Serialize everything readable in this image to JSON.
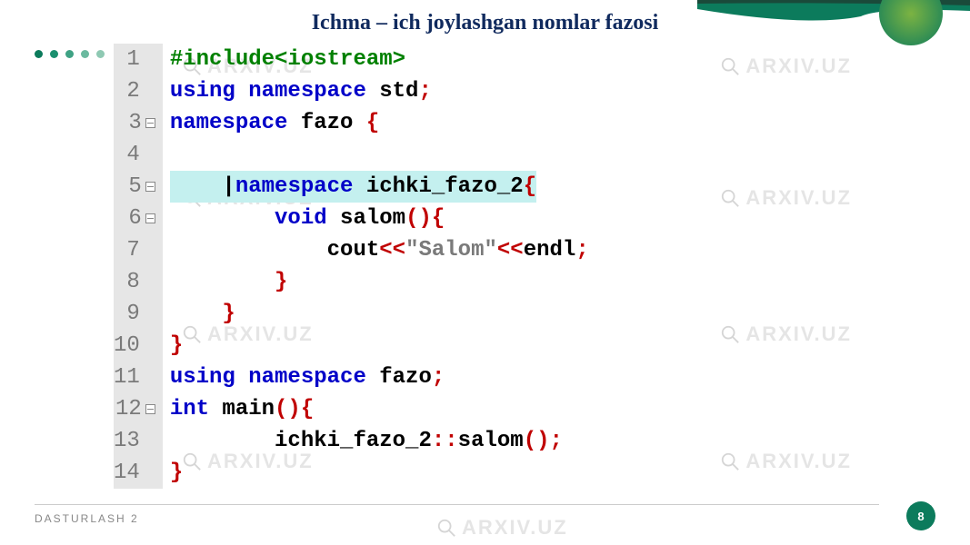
{
  "title": "Ichma – ich joylashgan nomlar fazosi",
  "footer": "DASTURLASH 2",
  "page_number": "8",
  "watermark_text": "ARXIV.UZ",
  "code": {
    "line_numbers": [
      "1",
      "2",
      "3",
      "4",
      "5",
      "6",
      "7",
      "8",
      "9",
      "10",
      "11",
      "12",
      "13",
      "14"
    ],
    "fold_lines": [
      3,
      5,
      6,
      12
    ],
    "lines": [
      {
        "t": "include",
        "tokens": [
          {
            "text": "#include<iostream>",
            "class": "c-green"
          }
        ]
      },
      {
        "t": "using_std",
        "tokens": [
          {
            "text": "using namespace ",
            "class": "c-blue"
          },
          {
            "text": "std",
            "class": "c-black"
          },
          {
            "text": ";",
            "class": "c-red"
          }
        ]
      },
      {
        "t": "ns_fazo",
        "tokens": [
          {
            "text": "namespace ",
            "class": "c-blue"
          },
          {
            "text": "fazo ",
            "class": "c-black"
          },
          {
            "text": "{",
            "class": "c-red"
          }
        ]
      },
      {
        "t": "blank",
        "tokens": [
          {
            "text": " ",
            "class": "c-black"
          }
        ]
      },
      {
        "t": "ns_ichki",
        "hl": true,
        "tokens": [
          {
            "text": "    ",
            "class": "c-black"
          },
          {
            "text": "|",
            "class": "c-black"
          },
          {
            "text": "namespace ",
            "class": "c-blue"
          },
          {
            "text": "ichki_fazo_2",
            "class": "c-black"
          },
          {
            "text": "{",
            "class": "c-red"
          }
        ]
      },
      {
        "t": "void_salom",
        "tokens": [
          {
            "text": "        ",
            "class": "c-black"
          },
          {
            "text": "void ",
            "class": "c-blue"
          },
          {
            "text": "salom",
            "class": "c-black"
          },
          {
            "text": "(){",
            "class": "c-red"
          }
        ]
      },
      {
        "t": "cout",
        "tokens": [
          {
            "text": "            cout",
            "class": "c-black"
          },
          {
            "text": "<<",
            "class": "c-red"
          },
          {
            "text": "\"Salom\"",
            "class": "c-gray"
          },
          {
            "text": "<<",
            "class": "c-red"
          },
          {
            "text": "endl",
            "class": "c-black"
          },
          {
            "text": ";",
            "class": "c-red"
          }
        ]
      },
      {
        "t": "close1",
        "tokens": [
          {
            "text": "        ",
            "class": "c-black"
          },
          {
            "text": "}",
            "class": "c-red"
          }
        ]
      },
      {
        "t": "close2",
        "tokens": [
          {
            "text": "    ",
            "class": "c-black"
          },
          {
            "text": "}",
            "class": "c-red"
          }
        ]
      },
      {
        "t": "close3",
        "tokens": [
          {
            "text": "}",
            "class": "c-red"
          }
        ]
      },
      {
        "t": "using_fazo",
        "tokens": [
          {
            "text": "using namespace ",
            "class": "c-blue"
          },
          {
            "text": "fazo",
            "class": "c-black"
          },
          {
            "text": ";",
            "class": "c-red"
          }
        ]
      },
      {
        "t": "int_main",
        "tokens": [
          {
            "text": "int ",
            "class": "c-blue"
          },
          {
            "text": "main",
            "class": "c-black"
          },
          {
            "text": "(){",
            "class": "c-red"
          }
        ]
      },
      {
        "t": "call",
        "tokens": [
          {
            "text": "        ichki_fazo_2",
            "class": "c-black"
          },
          {
            "text": "::",
            "class": "c-red"
          },
          {
            "text": "salom",
            "class": "c-black"
          },
          {
            "text": "();",
            "class": "c-red"
          }
        ]
      },
      {
        "t": "close4",
        "tokens": [
          {
            "text": "}",
            "class": "c-red"
          }
        ]
      }
    ]
  }
}
